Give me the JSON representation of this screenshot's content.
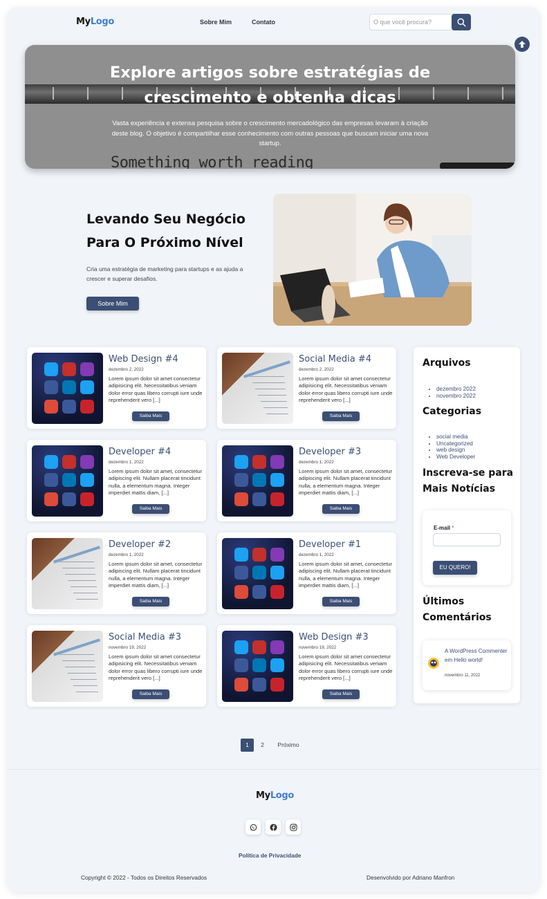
{
  "header": {
    "logo_part1": "My",
    "logo_part2": "Logo",
    "nav": [
      "Sobre Mim",
      "Contato"
    ],
    "search_placeholder": "O que você procura?"
  },
  "hero": {
    "title_line1": "Explore artigos sobre estratégias de",
    "title_line2": "crescimento e obtenha dicas",
    "description": "Vasta experiência e extensa pesquisa sobre o crescimento mercadológico das empresas levaram à criação deste blog. O objetivo é compartilhar esse conhecimento com outras pessoas que buscam iniciar uma nova startup.",
    "image_text": "Something worth reading"
  },
  "feature": {
    "title_line1": "Levando Seu Negócio",
    "title_line2": "Para O Próximo Nível",
    "text": "Cria uma estratégia de marketing para startups e as ajuda a crescer e superar desafios.",
    "button": "Sobre Mim"
  },
  "posts": [
    {
      "title": "Web Design #4",
      "date": "dezembro 2, 2022",
      "excerpt": "Lorem ipsum dolor sit amet consectetur adipisicing elit. Necessitatibus veniam dolor error quas libero corrupti iure unde reprehenderit vero [...]",
      "button": "Saiba Mais",
      "image": "social-phone"
    },
    {
      "title": "Social Media #4",
      "date": "dezembro 2, 2022",
      "excerpt": "Lorem ipsum dolor sit amet consectetur adipisicing elit. Necessitatibus veniam dolor error quas libero corrupti iure unde reprehenderit vero [...]",
      "button": "Saiba Mais",
      "image": "sketch-paper"
    },
    {
      "title": "Developer #4",
      "date": "dezembro 1, 2022",
      "excerpt": "Lorem ipsum dolor sit amet, consectetur adipiscing elit. Nullam placerat tincidunt nulla, a elementum magna. Integer imperdiet mattis diam, [...]",
      "button": "Saiba Mais",
      "image": "social-phone"
    },
    {
      "title": "Developer #3",
      "date": "dezembro 1, 2022",
      "excerpt": "Lorem ipsum dolor sit amet, consectetur adipiscing elit. Nullam placerat tincidunt nulla, a elementum magna. Integer imperdiet mattis diam, [...]",
      "button": "Saiba Mais",
      "image": "social-phone"
    },
    {
      "title": "Developer #2",
      "date": "dezembro 1, 2022",
      "excerpt": "Lorem ipsum dolor sit amet, consectetur adipiscing elit. Nullam placerat tincidunt nulla, a elementum magna. Integer imperdiet mattis diam, [...]",
      "button": "Saiba Mais",
      "image": "sketch-paper"
    },
    {
      "title": "Developer #1",
      "date": "dezembro 1, 2022",
      "excerpt": "Lorem ipsum dolor sit amet, consectetur adipiscing elit. Nullam placerat tincidunt nulla, a elementum magna. Integer imperdiet mattis diam, [...]",
      "button": "Saiba Mais",
      "image": "social-phone"
    },
    {
      "title": "Social Media #3",
      "date": "novembro 19, 2022",
      "excerpt": "Lorem ipsum dolor sit amet consectetur adipisicing elit. Necessitatibus veniam dolor error quas libero corrupti iure unde reprehenderit vero [...]",
      "button": "Saiba Mais",
      "image": "sketch-paper"
    },
    {
      "title": "Web Design #3",
      "date": "novembro 19, 2022",
      "excerpt": "Lorem ipsum dolor sit amet consectetur adipisicing elit. Necessitatibus veniam dolor error quas libero corrupti iure unde reprehenderit vero [...]",
      "button": "Saiba Mais",
      "image": "social-phone"
    }
  ],
  "sidebar": {
    "archives_title": "Arquivos",
    "archives": [
      "dezembro 2022",
      "novembro 2022"
    ],
    "categories_title": "Categorias",
    "categories": [
      "social media",
      "Uncategorized",
      "web design",
      "Web Developer"
    ],
    "newsletter_title_line1": "Inscreva-se para",
    "newsletter_title_line2": "Mais Notícias",
    "email_label": "E-mail",
    "required_mark": "*",
    "subscribe_button": "EU QUERO!",
    "comments_title_line1": "Últimos",
    "comments_title_line2": "Comentários",
    "comment_text": "A WordPress Commenter em Hello world!",
    "comment_date": "novembro 11, 2022"
  },
  "pagination": {
    "current": "1",
    "page2": "2",
    "next": "Próximo"
  },
  "footer": {
    "logo_part1": "My",
    "logo_part2": "Logo",
    "social_icons": [
      "whatsapp-icon",
      "facebook-icon",
      "instagram-icon"
    ],
    "privacy": "Política de Privacidade",
    "copyright": "Copyright © 2022 - Todos os Direitos Reservados",
    "developer": "Desenvolvido por Adriano Manfron"
  },
  "colors": {
    "accent": "#3b4e74",
    "logo_blue": "#3f7fd0",
    "background": "#f1f5f9"
  }
}
